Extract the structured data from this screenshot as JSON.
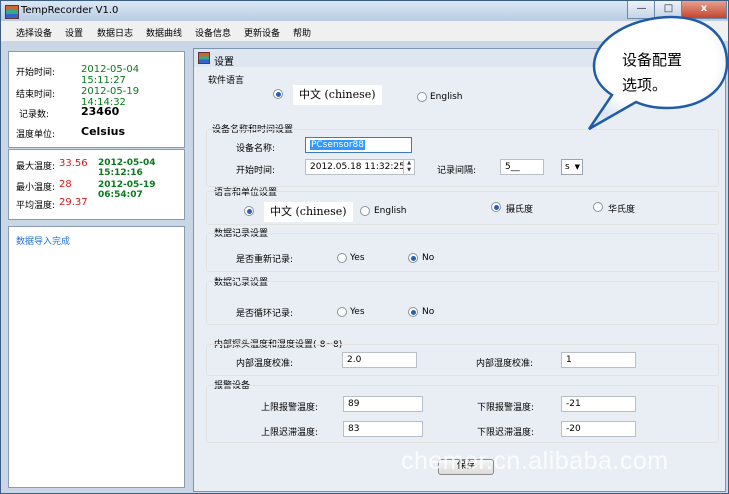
{
  "window": {
    "title": "TempRecorder V1.0",
    "controls": [
      "—",
      "□",
      "x"
    ]
  },
  "menubar": {
    "items": [
      "选择设备",
      "设置",
      "数据日志",
      "数据曲线",
      "设备信息",
      "更新设备",
      "帮助"
    ]
  },
  "summary": {
    "start_label": "开始时间:",
    "start_value": "2012-05-04 15:11:27",
    "end_label": "结束时间:",
    "end_value": "2012-05-19 14:14:32",
    "count_label": "记录数:",
    "count_value": "23460",
    "unit_label": "温度单位:",
    "unit_value": "Celsius"
  },
  "stats": {
    "max_label": "最大温度:",
    "max_value": "33.56",
    "max_time": "2012-05-04 15:12:16",
    "min_label": "最小温度:",
    "min_value": "28",
    "min_time": "2012-05-19 06:54:07",
    "avg_label": "平均温度:",
    "avg_value": "29.37"
  },
  "log": {
    "message": "数据导入完成"
  },
  "settings_window": {
    "title": "设置",
    "software_language": {
      "label": "软件语言",
      "option_chinese": "中文 (chinese)",
      "option_english": "English",
      "selected": "中文 (chinese)"
    },
    "device_name_time": {
      "label": "设备名称和时间设置",
      "name_label": "设备名称:",
      "name_value": "PCsensor88",
      "start_label": "开始时间:",
      "start_value": "2012.05.18 11:32:25",
      "interval_label": "记录间隔:",
      "interval_value": "5__",
      "interval_unit": "s"
    },
    "language_unit": {
      "label": "语言和单位设置",
      "option_chinese": "中文 (chinese)",
      "option_english": "English",
      "option_celsius": "摄氏度",
      "option_fahrenheit": "华氏度",
      "selected_language": "中文 (chinese)",
      "selected_unit": "摄氏度"
    },
    "record_restart": {
      "label": "数据记录设置",
      "question": "是否重新记录:",
      "yes": "Yes",
      "no": "No",
      "selected": "No"
    },
    "record_loop": {
      "label": "数据记录设置",
      "question": "是否循环记录:",
      "yes": "Yes",
      "no": "No",
      "selected": "No"
    },
    "calibration": {
      "label": "内部探头温度和湿度设置(-8~8)",
      "temp_label": "内部温度校准:",
      "temp_value": "2.0",
      "humidity_label": "内部湿度校准:",
      "humidity_value": "1"
    },
    "alarm": {
      "label": "报警设备",
      "upper_alarm_label": "上限报警温度:",
      "upper_alarm_value": "89",
      "lower_alarm_label": "下限报警温度:",
      "lower_alarm_value": "-21",
      "upper_delay_label": "上限迟滞温度:",
      "upper_delay_value": "83",
      "lower_delay_label": "下限迟滞温度:",
      "lower_delay_value": "-20"
    },
    "save_button": "保存"
  },
  "callout": {
    "line1": "设备配置",
    "line2": "选项。"
  },
  "watermark": {
    "text": "chemer.cn.alibaba.com"
  },
  "colors": {
    "accent_green": "#0a7a1e",
    "accent_red": "#d41a1a",
    "log_blue": "#1f6fd6"
  }
}
